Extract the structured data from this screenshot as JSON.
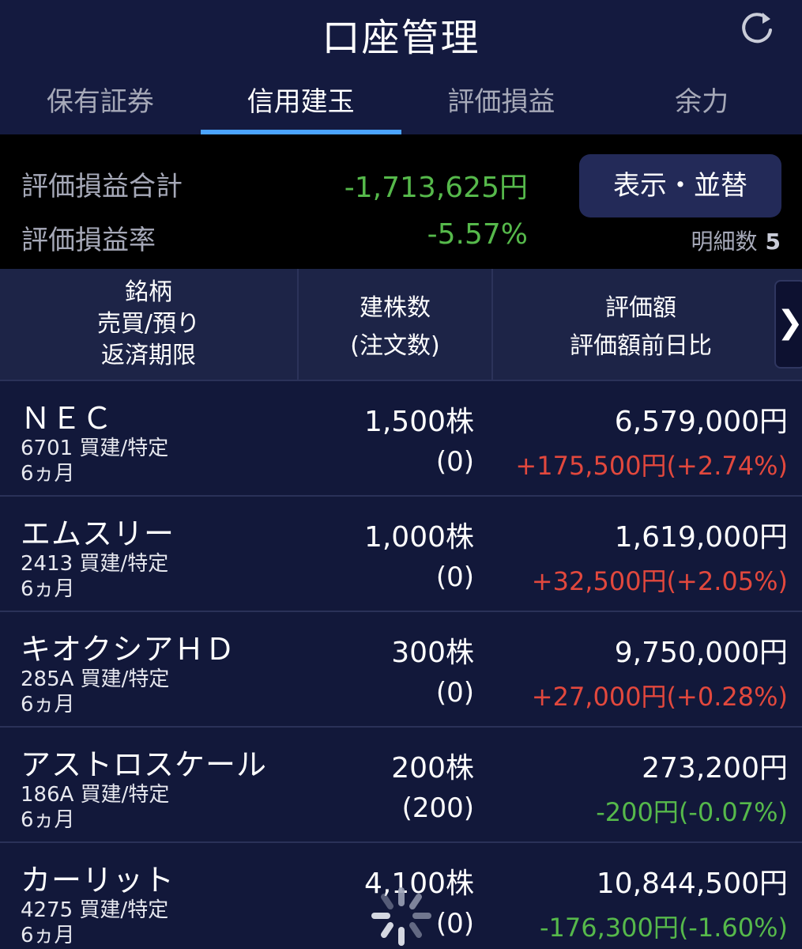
{
  "header": {
    "title": "口座管理"
  },
  "tabs": [
    {
      "label": "保有証券",
      "active": false
    },
    {
      "label": "信用建玉",
      "active": true
    },
    {
      "label": "評価損益",
      "active": false
    },
    {
      "label": "余力",
      "active": false
    }
  ],
  "summary": {
    "pl_total_label": "評価損益合計",
    "pl_total_value": "-1,713,625円",
    "pl_rate_label": "評価損益率",
    "pl_rate_value": "-5.57%",
    "sort_button": "表示・並替",
    "count_label": "明細数",
    "count_value": "5"
  },
  "table": {
    "col1": [
      "銘柄",
      "売買/預り",
      "返済期限"
    ],
    "col2": [
      "建株数",
      "(注文数)"
    ],
    "col3": [
      "評価額",
      "評価額前日比"
    ],
    "next_icon": "chevron-right-icon",
    "rows": [
      {
        "name": "ＮＥＣ",
        "code": "6701 買建/特定",
        "term": "6ヵ月",
        "qty": "1,500株",
        "order": "(0)",
        "value": "6,579,000円",
        "change": "+175,500円(+2.74%)",
        "dir": "pos"
      },
      {
        "name": "エムスリー",
        "code": "2413 買建/特定",
        "term": "6ヵ月",
        "qty": "1,000株",
        "order": "(0)",
        "value": "1,619,000円",
        "change": "+32,500円(+2.05%)",
        "dir": "pos"
      },
      {
        "name": "キオクシアＨＤ",
        "code": "285A 買建/特定",
        "term": "6ヵ月",
        "qty": "300株",
        "order": "(0)",
        "value": "9,750,000円",
        "change": "+27,000円(+0.28%)",
        "dir": "pos"
      },
      {
        "name": "アストロスケール",
        "code": "186A 買建/特定",
        "term": "6ヵ月",
        "qty": "200株",
        "order": "(200)",
        "value": "273,200円",
        "change": "-200円(-0.07%)",
        "dir": "neg"
      },
      {
        "name": "カーリット",
        "code": "4275 買建/特定",
        "term": "6ヵ月",
        "qty": "4,100株",
        "order": "(0)",
        "value": "10,844,500円",
        "change": "-176,300円(-1.60%)",
        "dir": "neg"
      }
    ]
  },
  "colors": {
    "positive": "#e2483d",
    "negative": "#56b94b",
    "tab_indicator": "#4aa3ff"
  }
}
